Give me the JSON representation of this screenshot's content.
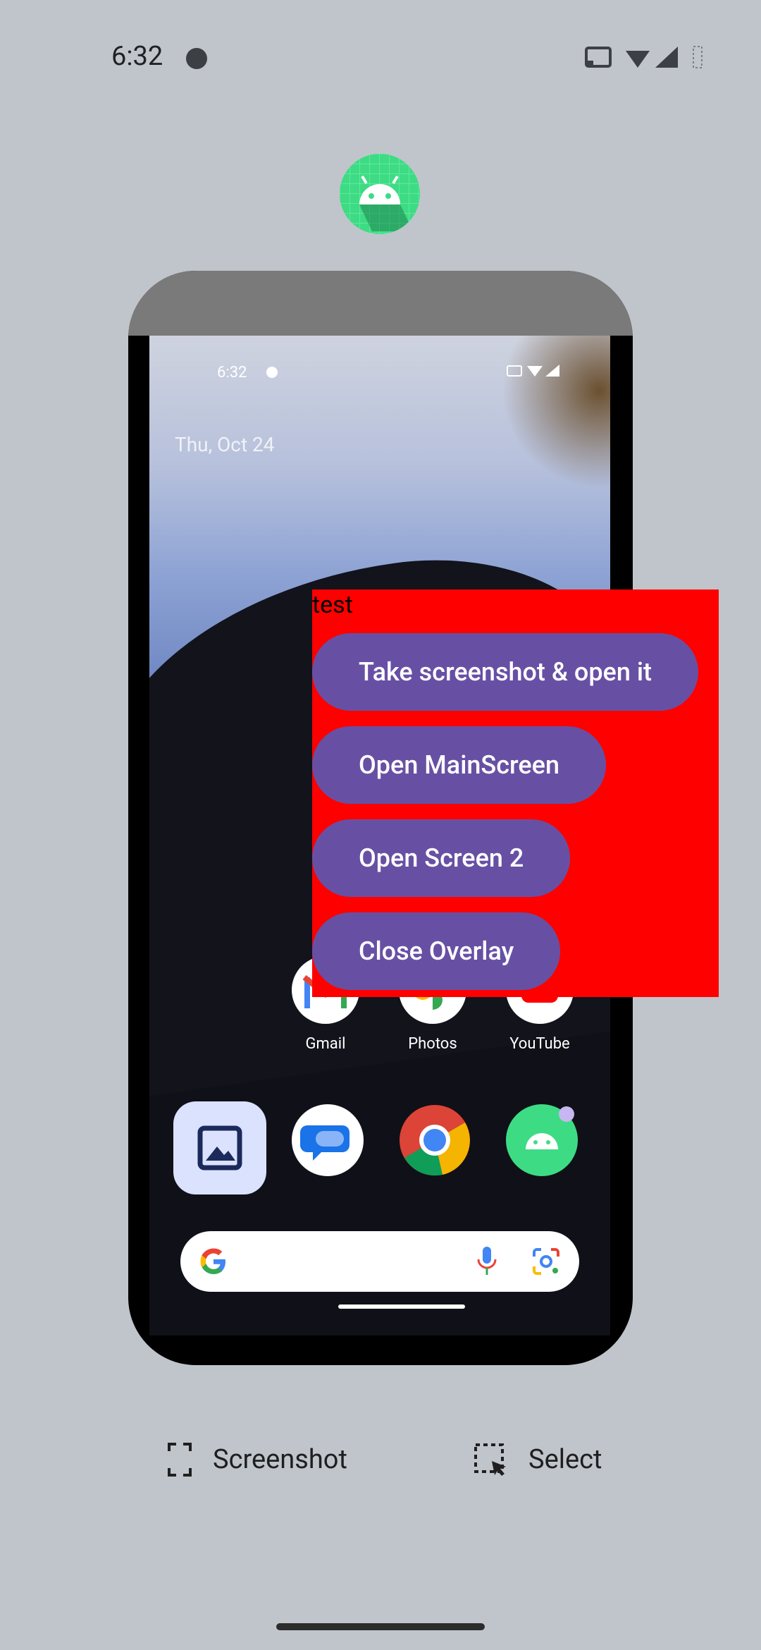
{
  "status_bar": {
    "time": "6:32",
    "icons": [
      "cast-icon",
      "wifi-icon",
      "signal-icon",
      "battery-icon"
    ]
  },
  "preview": {
    "status_time": "6:32",
    "date": "Thu, Oct 24",
    "apps_row": [
      {
        "label": "Gmail",
        "icon": "gmail-icon"
      },
      {
        "label": "Photos",
        "icon": "photos-icon"
      },
      {
        "label": "YouTube",
        "icon": "youtube-icon"
      }
    ],
    "dock": [
      "gallery-icon",
      "messages-icon",
      "chrome-icon",
      "android-app-icon"
    ]
  },
  "overlay": {
    "label": "test",
    "buttons": [
      {
        "label": "Take screenshot & open it"
      },
      {
        "label": "Open MainScreen"
      },
      {
        "label": "Open Screen 2"
      },
      {
        "label": "Close Overlay"
      }
    ],
    "background_color": "#ff0000",
    "button_color": "#6750a4"
  },
  "actions": {
    "screenshot_label": "Screenshot",
    "select_label": "Select"
  }
}
